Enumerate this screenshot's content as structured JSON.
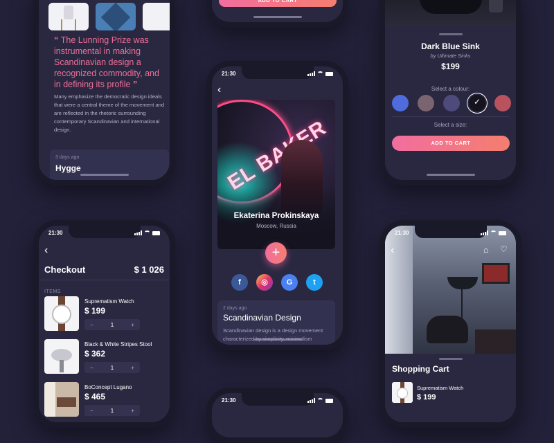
{
  "colors": {
    "accent": "#f26e9f",
    "bg": "#23213a",
    "card": "#2a2840"
  },
  "article": {
    "quote": "The Lunning Prize was instrumental in making Scandinavian design a recognized commodity, and in defining its profile",
    "body": "Many emphasize the democratic design ideals that were a central theme of the movement and are reflected in the rhetoric surrounding contemporary Scandinavian and international design.",
    "next_meta": "3 days ago",
    "next_title": "Hygge"
  },
  "top_cart": {
    "button": "ADD TO CART"
  },
  "sink": {
    "title": "Dark Blue Sink",
    "by": "by Ultimate Sinks",
    "price": "$199",
    "colour_label": "Select a colour:",
    "size_label": "Select a size:",
    "swatches": [
      "#4f6bdc",
      "#7a6470",
      "#4f4a7c",
      "#15141e",
      "#b8535d"
    ],
    "selected_check": "✓",
    "button": "ADD TO CART"
  },
  "profile": {
    "time": "21:30",
    "neon_text": "EL BAKER",
    "name": "Ekaterina Prokinskaya",
    "location": "Moscow, Russia",
    "fab": "+",
    "socials": [
      {
        "name": "facebook",
        "glyph": "f",
        "color": "#3b5998"
      },
      {
        "name": "instagram",
        "glyph": "◎",
        "color": "#d6338a"
      },
      {
        "name": "google",
        "glyph": "G",
        "color": "#4a80f0"
      },
      {
        "name": "twitter",
        "glyph": "t",
        "color": "#1da1f2"
      }
    ],
    "article_meta": "2 days ago",
    "article_title": "Scandinavian Design",
    "article_excerpt": "Scandinavian design is a design movement characterized by simplicity, minimalism"
  },
  "checkout": {
    "time": "21:30",
    "title": "Checkout",
    "total": "$ 1 026",
    "items_label": "ITEMS",
    "items": [
      {
        "name": "Suprematism Watch",
        "price": "$ 199",
        "qty": "1"
      },
      {
        "name": "Black & White Stripes Stool",
        "price": "$ 362",
        "qty": "1"
      },
      {
        "name": "BoConcept Lugano",
        "price": "$ 465",
        "qty": "1"
      }
    ],
    "minus": "−",
    "plus": "+"
  },
  "bottom": {
    "time": "21:30"
  },
  "cart": {
    "time": "21:30",
    "title": "Shopping Cart",
    "item_name": "Suprematism Watch",
    "item_price": "$ 199"
  }
}
